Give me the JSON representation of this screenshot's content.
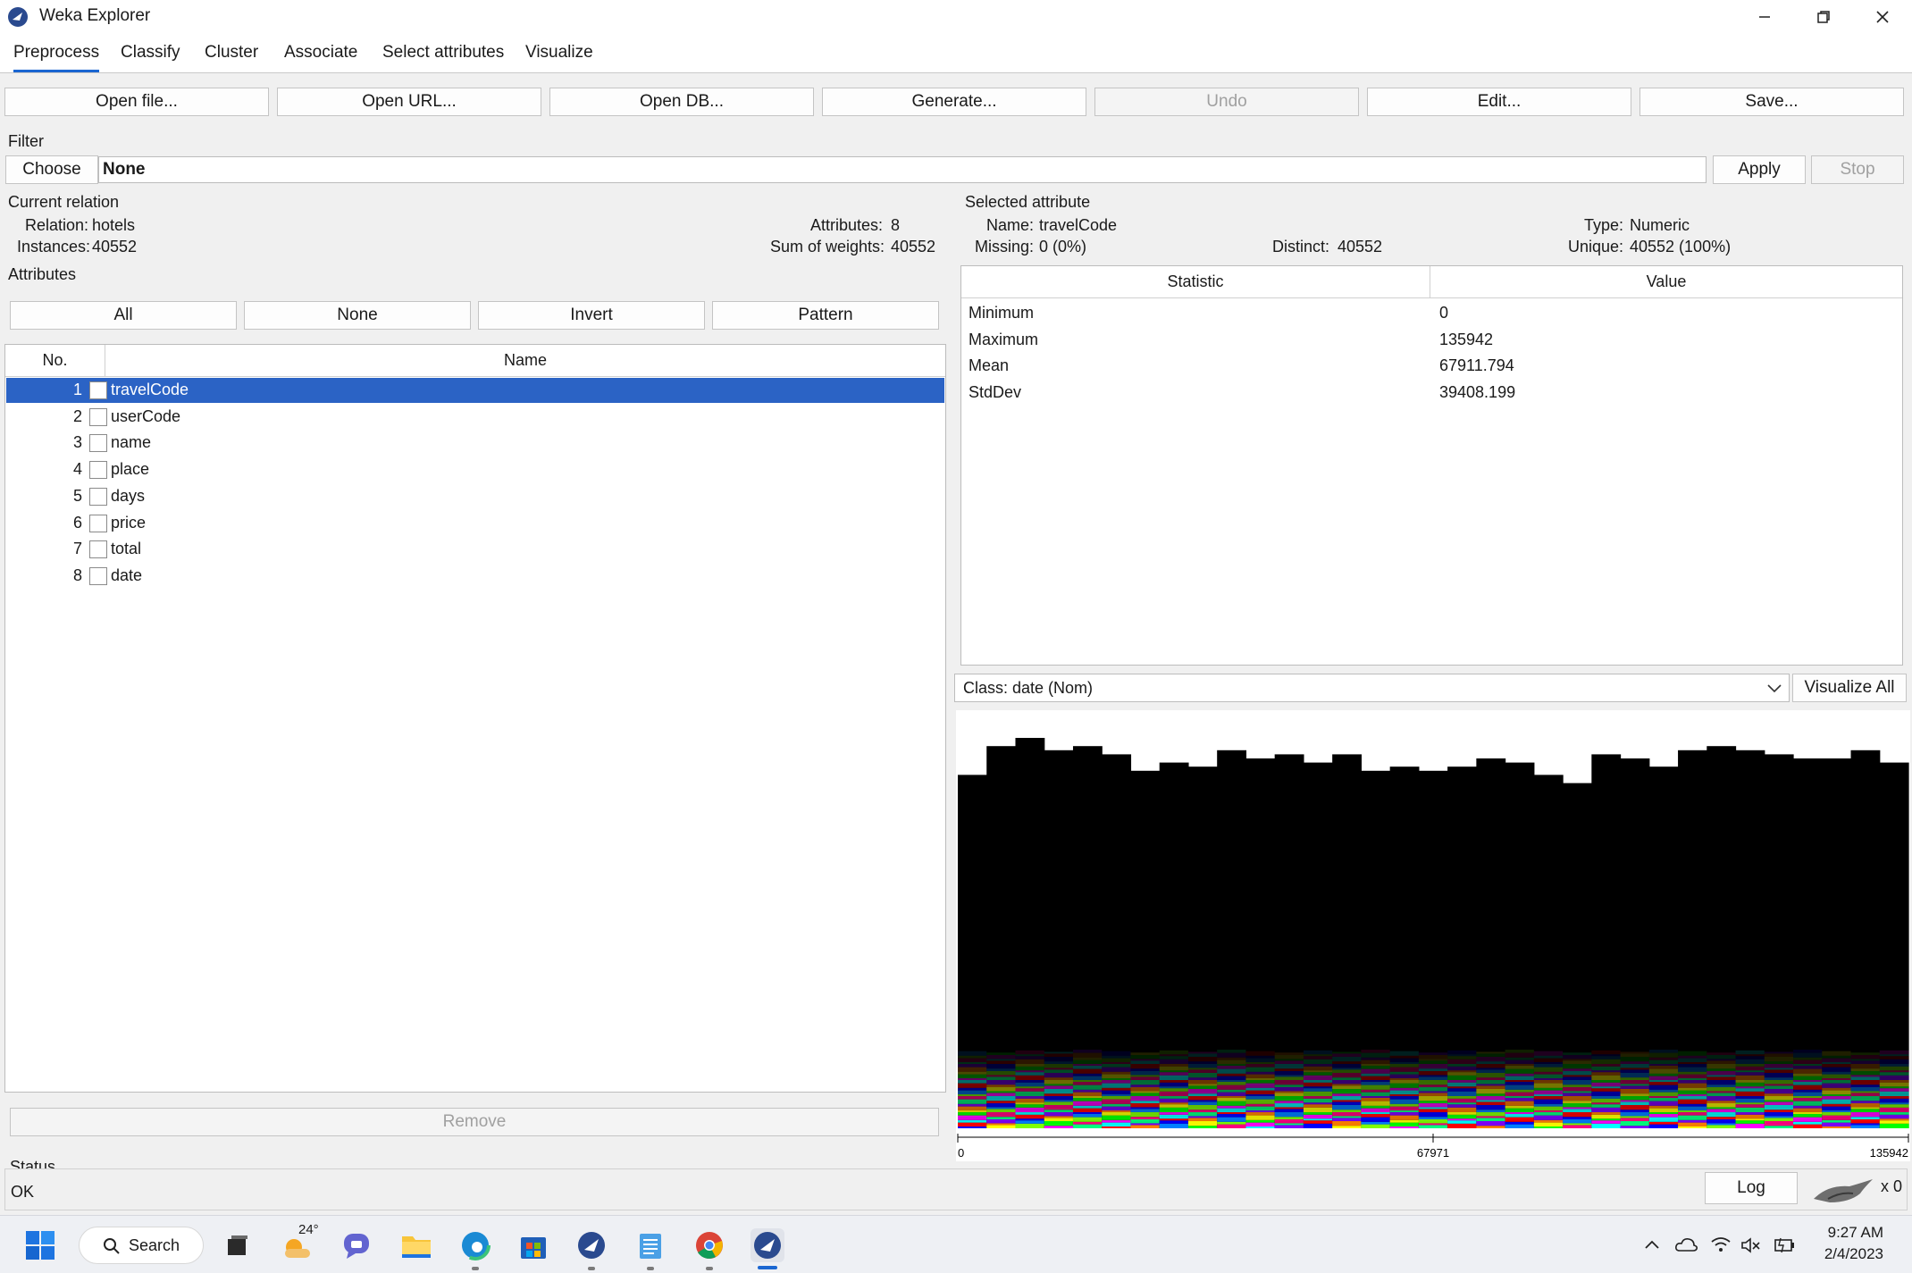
{
  "window": {
    "title": "Weka Explorer"
  },
  "tabs": [
    "Preprocess",
    "Classify",
    "Cluster",
    "Associate",
    "Select attributes",
    "Visualize"
  ],
  "toolbar": {
    "open_file": "Open file...",
    "open_url": "Open URL...",
    "open_db": "Open DB...",
    "generate": "Generate...",
    "undo": "Undo",
    "edit": "Edit...",
    "save": "Save..."
  },
  "filter": {
    "group_label": "Filter",
    "choose_label": "Choose",
    "value": "None",
    "apply_label": "Apply",
    "stop_label": "Stop"
  },
  "relation": {
    "group_label": "Current relation",
    "relation_label": "Relation:",
    "relation_value": "hotels",
    "instances_label": "Instances:",
    "instances_value": "40552",
    "attributes_label": "Attributes:",
    "attributes_value": "8",
    "weights_label": "Sum of weights:",
    "weights_value": "40552"
  },
  "attributes": {
    "group_label": "Attributes",
    "all_label": "All",
    "none_label": "None",
    "invert_label": "Invert",
    "pattern_label": "Pattern",
    "col_no": "No.",
    "col_name": "Name",
    "rows": [
      {
        "no": "1",
        "name": "travelCode",
        "selected": true
      },
      {
        "no": "2",
        "name": "userCode",
        "selected": false
      },
      {
        "no": "3",
        "name": "name",
        "selected": false
      },
      {
        "no": "4",
        "name": "place",
        "selected": false
      },
      {
        "no": "5",
        "name": "days",
        "selected": false
      },
      {
        "no": "6",
        "name": "price",
        "selected": false
      },
      {
        "no": "7",
        "name": "total",
        "selected": false
      },
      {
        "no": "8",
        "name": "date",
        "selected": false
      }
    ],
    "remove_label": "Remove"
  },
  "selected_attribute": {
    "group_label": "Selected attribute",
    "name_label": "Name:",
    "name_value": "travelCode",
    "type_label": "Type:",
    "type_value": "Numeric",
    "missing_label": "Missing:",
    "missing_value": "0 (0%)",
    "distinct_label": "Distinct:",
    "distinct_value": "40552",
    "unique_label": "Unique:",
    "unique_value": "40552 (100%)",
    "col_statistic": "Statistic",
    "col_value": "Value",
    "stats": [
      {
        "k": "Minimum",
        "v": "0"
      },
      {
        "k": "Maximum",
        "v": "135942"
      },
      {
        "k": "Mean",
        "v": "67911.794"
      },
      {
        "k": "StdDev",
        "v": "39408.199"
      }
    ]
  },
  "class_select": {
    "value": "Class: date (Nom)",
    "visualize_all_label": "Visualize All"
  },
  "histogram": {
    "axis_min": "0",
    "axis_mid": "67971",
    "axis_max": "135942",
    "bar_heights": [
      0.86,
      0.93,
      0.95,
      0.92,
      0.93,
      0.91,
      0.87,
      0.89,
      0.88,
      0.92,
      0.9,
      0.91,
      0.89,
      0.91,
      0.87,
      0.88,
      0.87,
      0.88,
      0.9,
      0.89,
      0.86,
      0.84,
      0.91,
      0.9,
      0.88,
      0.92,
      0.93,
      0.92,
      0.91,
      0.9,
      0.9,
      0.92,
      0.89
    ],
    "class_colors": [
      "#0000ff",
      "#ff0000",
      "#00ffff",
      "#ff00ff",
      "#00ff00",
      "#ffff00",
      "#ff8000",
      "#8000ff",
      "#00ff80",
      "#ff0080",
      "#80ff00",
      "#0080ff"
    ]
  },
  "status": {
    "group_label": "Status",
    "text": "OK",
    "log_label": "Log",
    "x_count": "x 0"
  },
  "taskbar": {
    "search_label": "Search",
    "weather": "24°",
    "time": "9:27 AM",
    "date": "2/4/2023"
  }
}
